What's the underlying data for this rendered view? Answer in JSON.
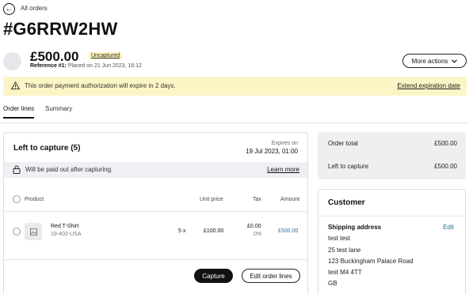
{
  "nav": {
    "back_label": "All orders",
    "back_icon": "arrow-left-icon"
  },
  "order": {
    "id": "#G6RRW2HW",
    "amount": "£500.00",
    "status_badge": "Uncaptured",
    "reference_label": "Reference #1:",
    "placed_on": "Placed on 21 Jun 2023, 16:12",
    "more_actions_label": "More actions"
  },
  "banner": {
    "text": "This order payment authorization will expire in 2 days.",
    "link": "Extend expiration date",
    "color": "#fbf5c6"
  },
  "tabs": [
    {
      "label": "Order lines",
      "active": true
    },
    {
      "label": "Summary",
      "active": false
    }
  ],
  "capture_card": {
    "title": "Left to capture (5)",
    "expires_label": "Expires on",
    "expires_date": "19 Jul 2023, 01:00",
    "payout_text": "Will be paid out after capturing.",
    "learn_more": "Learn more",
    "columns": {
      "product": "Product",
      "unit_price": "Unit price",
      "tax": "Tax",
      "amount": "Amount"
    },
    "lines": [
      {
        "name": "Red T-Shirt",
        "sku": "19-402-USA",
        "qty": "5 x",
        "unit_price": "£100.00",
        "tax": "£0.00",
        "tax_rate": "0%",
        "amount": "£500.00"
      }
    ],
    "capture_button": "Capture",
    "edit_button": "Edit order lines"
  },
  "totals": {
    "order_total_label": "Order total",
    "order_total": "£500.00",
    "left_to_capture_label": "Left to capture",
    "left_to_capture": "£500.00"
  },
  "customer": {
    "title": "Customer",
    "shipping_label": "Shipping address",
    "edit_label": "Edit",
    "address": [
      "test test",
      "25 test lane",
      "123 Buckingham Palace Road",
      "test  M4 4TT",
      "GB"
    ]
  },
  "colors": {
    "link": "#2b6f93",
    "amount_link": "#2b6f93",
    "badge": "#fbf2b5"
  }
}
